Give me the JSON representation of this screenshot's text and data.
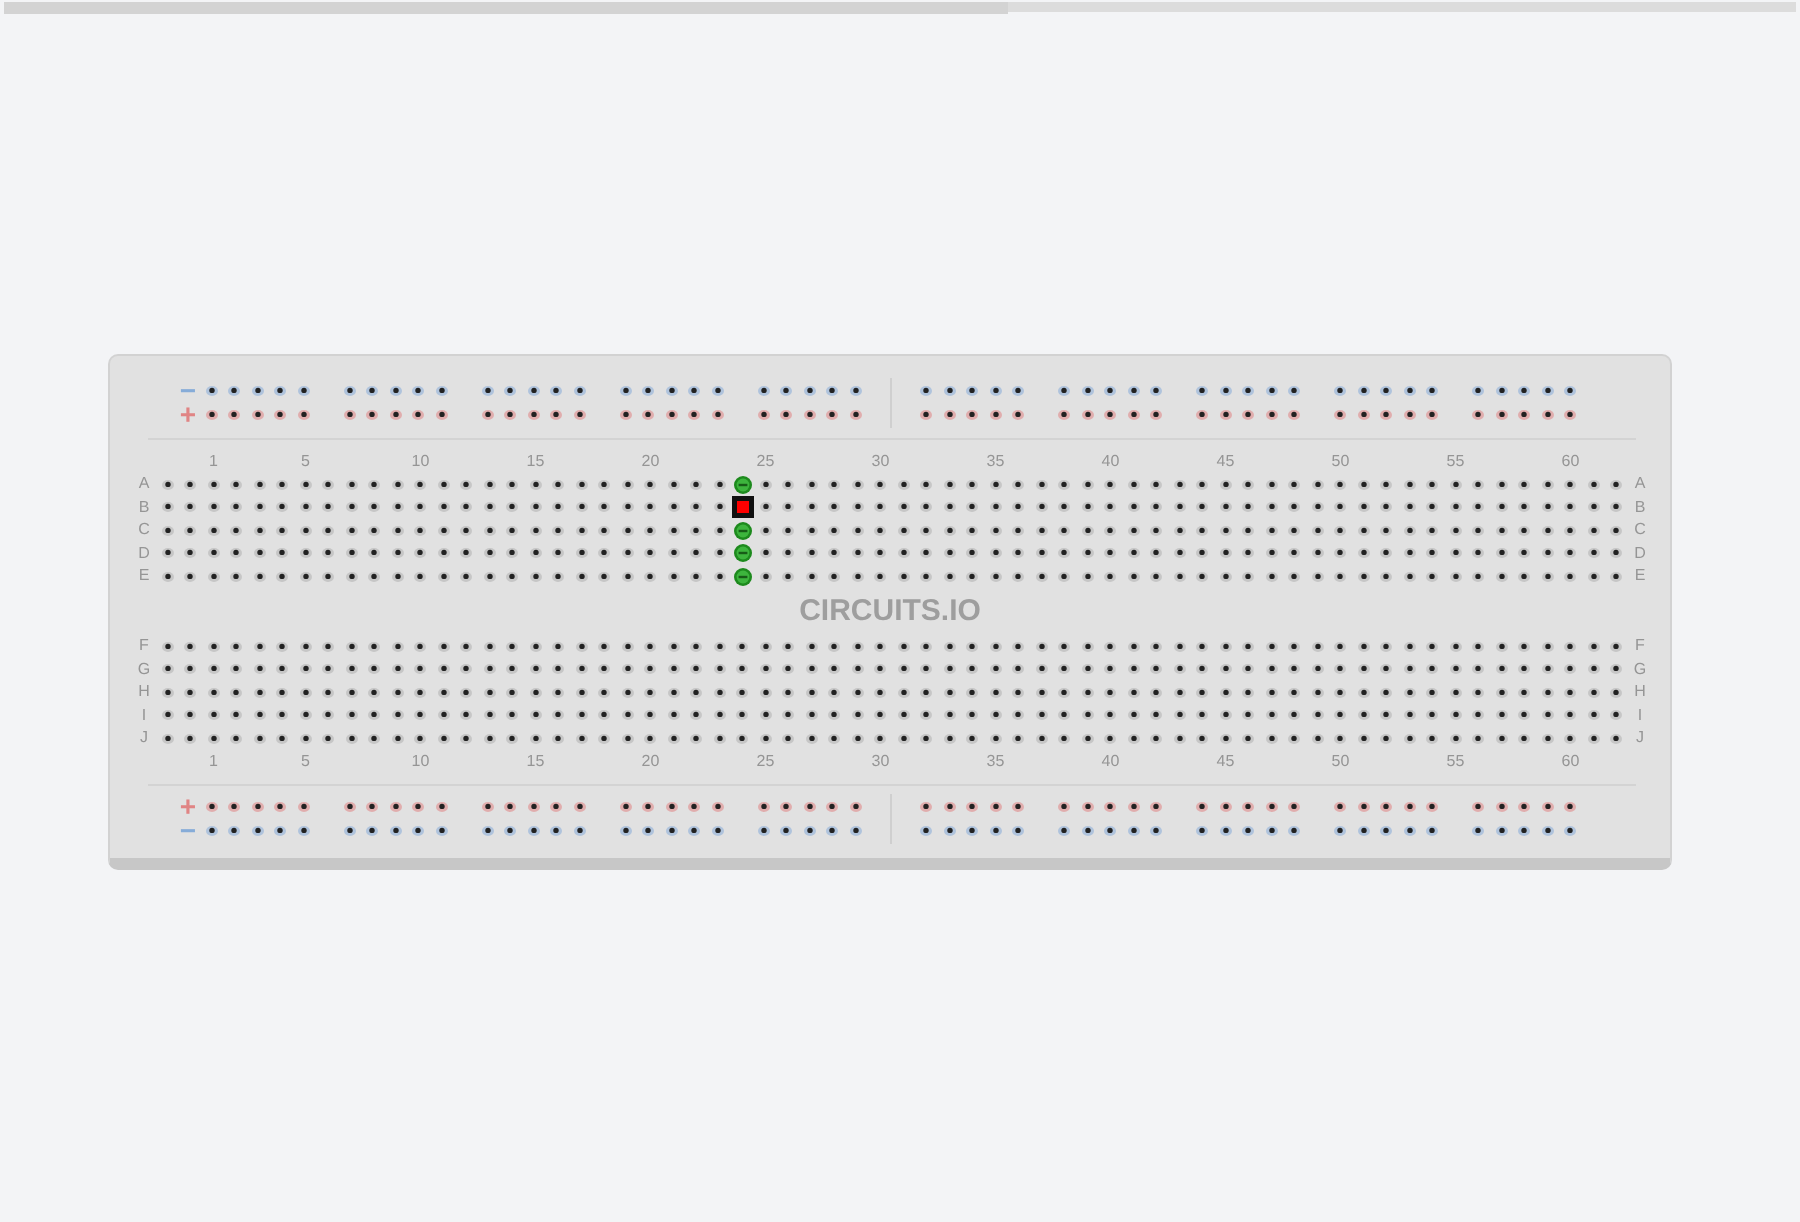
{
  "top_bar": {
    "level": 0.56
  },
  "breadboard": {
    "top_rails": [
      {
        "sign": "−",
        "color": "#86acd8"
      },
      {
        "sign": "+",
        "color": "#e08484"
      }
    ],
    "top_column_numbers": [
      "1",
      "5",
      "10",
      "15",
      "20",
      "25",
      "30",
      "35",
      "40",
      "45",
      "50",
      "55",
      "60"
    ],
    "terminal_rows_upper": [
      {
        "label": "A",
        "label_right": "A",
        "holes": [
          {
            "kind": "open"
          },
          {
            "kind": "open"
          },
          {
            "kind": "open"
          },
          {
            "kind": "open"
          },
          {
            "kind": "open"
          },
          {
            "kind": "open"
          },
          {
            "kind": "open"
          },
          {
            "kind": "open"
          },
          {
            "kind": "open"
          },
          {
            "kind": "open"
          },
          {
            "kind": "open"
          },
          {
            "kind": "open"
          },
          {
            "kind": "open"
          },
          {
            "kind": "open"
          },
          {
            "kind": "open"
          },
          {
            "kind": "open"
          },
          {
            "kind": "open"
          },
          {
            "kind": "open"
          },
          {
            "kind": "open"
          },
          {
            "kind": "open"
          },
          {
            "kind": "open"
          },
          {
            "kind": "open"
          },
          {
            "kind": "open"
          },
          {
            "kind": "open"
          },
          {
            "kind": "open"
          },
          {
            "kind": "connected"
          },
          {
            "kind": "open"
          },
          {
            "kind": "open"
          },
          {
            "kind": "open"
          },
          {
            "kind": "open"
          },
          {
            "kind": "open"
          },
          {
            "kind": "open"
          },
          {
            "kind": "open"
          },
          {
            "kind": "open"
          },
          {
            "kind": "open"
          },
          {
            "kind": "open"
          },
          {
            "kind": "open"
          },
          {
            "kind": "open"
          },
          {
            "kind": "open"
          },
          {
            "kind": "open"
          },
          {
            "kind": "open"
          },
          {
            "kind": "open"
          },
          {
            "kind": "open"
          },
          {
            "kind": "open"
          },
          {
            "kind": "open"
          },
          {
            "kind": "open"
          },
          {
            "kind": "open"
          },
          {
            "kind": "open"
          },
          {
            "kind": "open"
          },
          {
            "kind": "open"
          },
          {
            "kind": "open"
          },
          {
            "kind": "open"
          },
          {
            "kind": "open"
          },
          {
            "kind": "open"
          },
          {
            "kind": "open"
          },
          {
            "kind": "open"
          },
          {
            "kind": "open"
          },
          {
            "kind": "open"
          },
          {
            "kind": "open"
          },
          {
            "kind": "open"
          },
          {
            "kind": "open"
          },
          {
            "kind": "open"
          },
          {
            "kind": "open"
          },
          {
            "kind": "open"
          }
        ]
      },
      {
        "label": "B",
        "label_right": "B",
        "holes": [
          {
            "kind": "open"
          },
          {
            "kind": "open"
          },
          {
            "kind": "open"
          },
          {
            "kind": "open"
          },
          {
            "kind": "open"
          },
          {
            "kind": "open"
          },
          {
            "kind": "open"
          },
          {
            "kind": "open"
          },
          {
            "kind": "open"
          },
          {
            "kind": "open"
          },
          {
            "kind": "open"
          },
          {
            "kind": "open"
          },
          {
            "kind": "open"
          },
          {
            "kind": "open"
          },
          {
            "kind": "open"
          },
          {
            "kind": "open"
          },
          {
            "kind": "open"
          },
          {
            "kind": "open"
          },
          {
            "kind": "open"
          },
          {
            "kind": "open"
          },
          {
            "kind": "open"
          },
          {
            "kind": "open"
          },
          {
            "kind": "open"
          },
          {
            "kind": "open"
          },
          {
            "kind": "open"
          },
          {
            "kind": "selected"
          },
          {
            "kind": "open"
          },
          {
            "kind": "open"
          },
          {
            "kind": "open"
          },
          {
            "kind": "open"
          },
          {
            "kind": "open"
          },
          {
            "kind": "open"
          },
          {
            "kind": "open"
          },
          {
            "kind": "open"
          },
          {
            "kind": "open"
          },
          {
            "kind": "open"
          },
          {
            "kind": "open"
          },
          {
            "kind": "open"
          },
          {
            "kind": "open"
          },
          {
            "kind": "open"
          },
          {
            "kind": "open"
          },
          {
            "kind": "open"
          },
          {
            "kind": "open"
          },
          {
            "kind": "open"
          },
          {
            "kind": "open"
          },
          {
            "kind": "open"
          },
          {
            "kind": "open"
          },
          {
            "kind": "open"
          },
          {
            "kind": "open"
          },
          {
            "kind": "open"
          },
          {
            "kind": "open"
          },
          {
            "kind": "open"
          },
          {
            "kind": "open"
          },
          {
            "kind": "open"
          },
          {
            "kind": "open"
          },
          {
            "kind": "open"
          },
          {
            "kind": "open"
          },
          {
            "kind": "open"
          },
          {
            "kind": "open"
          },
          {
            "kind": "open"
          },
          {
            "kind": "open"
          },
          {
            "kind": "open"
          },
          {
            "kind": "open"
          },
          {
            "kind": "open"
          }
        ]
      },
      {
        "label": "C",
        "label_right": "C",
        "holes": [
          {
            "kind": "open"
          },
          {
            "kind": "open"
          },
          {
            "kind": "open"
          },
          {
            "kind": "open"
          },
          {
            "kind": "open"
          },
          {
            "kind": "open"
          },
          {
            "kind": "open"
          },
          {
            "kind": "open"
          },
          {
            "kind": "open"
          },
          {
            "kind": "open"
          },
          {
            "kind": "open"
          },
          {
            "kind": "open"
          },
          {
            "kind": "open"
          },
          {
            "kind": "open"
          },
          {
            "kind": "open"
          },
          {
            "kind": "open"
          },
          {
            "kind": "open"
          },
          {
            "kind": "open"
          },
          {
            "kind": "open"
          },
          {
            "kind": "open"
          },
          {
            "kind": "open"
          },
          {
            "kind": "open"
          },
          {
            "kind": "open"
          },
          {
            "kind": "open"
          },
          {
            "kind": "open"
          },
          {
            "kind": "connected"
          },
          {
            "kind": "open"
          },
          {
            "kind": "open"
          },
          {
            "kind": "open"
          },
          {
            "kind": "open"
          },
          {
            "kind": "open"
          },
          {
            "kind": "open"
          },
          {
            "kind": "open"
          },
          {
            "kind": "open"
          },
          {
            "kind": "open"
          },
          {
            "kind": "open"
          },
          {
            "kind": "open"
          },
          {
            "kind": "open"
          },
          {
            "kind": "open"
          },
          {
            "kind": "open"
          },
          {
            "kind": "open"
          },
          {
            "kind": "open"
          },
          {
            "kind": "open"
          },
          {
            "kind": "open"
          },
          {
            "kind": "open"
          },
          {
            "kind": "open"
          },
          {
            "kind": "open"
          },
          {
            "kind": "open"
          },
          {
            "kind": "open"
          },
          {
            "kind": "open"
          },
          {
            "kind": "open"
          },
          {
            "kind": "open"
          },
          {
            "kind": "open"
          },
          {
            "kind": "open"
          },
          {
            "kind": "open"
          },
          {
            "kind": "open"
          },
          {
            "kind": "open"
          },
          {
            "kind": "open"
          },
          {
            "kind": "open"
          },
          {
            "kind": "open"
          },
          {
            "kind": "open"
          },
          {
            "kind": "open"
          },
          {
            "kind": "open"
          },
          {
            "kind": "open"
          }
        ]
      },
      {
        "label": "D",
        "label_right": "D",
        "holes": [
          {
            "kind": "open"
          },
          {
            "kind": "open"
          },
          {
            "kind": "open"
          },
          {
            "kind": "open"
          },
          {
            "kind": "open"
          },
          {
            "kind": "open"
          },
          {
            "kind": "open"
          },
          {
            "kind": "open"
          },
          {
            "kind": "open"
          },
          {
            "kind": "open"
          },
          {
            "kind": "open"
          },
          {
            "kind": "open"
          },
          {
            "kind": "open"
          },
          {
            "kind": "open"
          },
          {
            "kind": "open"
          },
          {
            "kind": "open"
          },
          {
            "kind": "open"
          },
          {
            "kind": "open"
          },
          {
            "kind": "open"
          },
          {
            "kind": "open"
          },
          {
            "kind": "open"
          },
          {
            "kind": "open"
          },
          {
            "kind": "open"
          },
          {
            "kind": "open"
          },
          {
            "kind": "open"
          },
          {
            "kind": "connected"
          },
          {
            "kind": "open"
          },
          {
            "kind": "open"
          },
          {
            "kind": "open"
          },
          {
            "kind": "open"
          },
          {
            "kind": "open"
          },
          {
            "kind": "open"
          },
          {
            "kind": "open"
          },
          {
            "kind": "open"
          },
          {
            "kind": "open"
          },
          {
            "kind": "open"
          },
          {
            "kind": "open"
          },
          {
            "kind": "open"
          },
          {
            "kind": "open"
          },
          {
            "kind": "open"
          },
          {
            "kind": "open"
          },
          {
            "kind": "open"
          },
          {
            "kind": "open"
          },
          {
            "kind": "open"
          },
          {
            "kind": "open"
          },
          {
            "kind": "open"
          },
          {
            "kind": "open"
          },
          {
            "kind": "open"
          },
          {
            "kind": "open"
          },
          {
            "kind": "open"
          },
          {
            "kind": "open"
          },
          {
            "kind": "open"
          },
          {
            "kind": "open"
          },
          {
            "kind": "open"
          },
          {
            "kind": "open"
          },
          {
            "kind": "open"
          },
          {
            "kind": "open"
          },
          {
            "kind": "open"
          },
          {
            "kind": "open"
          },
          {
            "kind": "open"
          },
          {
            "kind": "open"
          },
          {
            "kind": "open"
          },
          {
            "kind": "open"
          },
          {
            "kind": "open"
          }
        ]
      },
      {
        "label": "E",
        "label_right": "E",
        "holes": [
          {
            "kind": "open"
          },
          {
            "kind": "open"
          },
          {
            "kind": "open"
          },
          {
            "kind": "open"
          },
          {
            "kind": "open"
          },
          {
            "kind": "open"
          },
          {
            "kind": "open"
          },
          {
            "kind": "open"
          },
          {
            "kind": "open"
          },
          {
            "kind": "open"
          },
          {
            "kind": "open"
          },
          {
            "kind": "open"
          },
          {
            "kind": "open"
          },
          {
            "kind": "open"
          },
          {
            "kind": "open"
          },
          {
            "kind": "open"
          },
          {
            "kind": "open"
          },
          {
            "kind": "open"
          },
          {
            "kind": "open"
          },
          {
            "kind": "open"
          },
          {
            "kind": "open"
          },
          {
            "kind": "open"
          },
          {
            "kind": "open"
          },
          {
            "kind": "open"
          },
          {
            "kind": "open"
          },
          {
            "kind": "connected"
          },
          {
            "kind": "open"
          },
          {
            "kind": "open"
          },
          {
            "kind": "open"
          },
          {
            "kind": "open"
          },
          {
            "kind": "open"
          },
          {
            "kind": "open"
          },
          {
            "kind": "open"
          },
          {
            "kind": "open"
          },
          {
            "kind": "open"
          },
          {
            "kind": "open"
          },
          {
            "kind": "open"
          },
          {
            "kind": "open"
          },
          {
            "kind": "open"
          },
          {
            "kind": "open"
          },
          {
            "kind": "open"
          },
          {
            "kind": "open"
          },
          {
            "kind": "open"
          },
          {
            "kind": "open"
          },
          {
            "kind": "open"
          },
          {
            "kind": "open"
          },
          {
            "kind": "open"
          },
          {
            "kind": "open"
          },
          {
            "kind": "open"
          },
          {
            "kind": "open"
          },
          {
            "kind": "open"
          },
          {
            "kind": "open"
          },
          {
            "kind": "open"
          },
          {
            "kind": "open"
          },
          {
            "kind": "open"
          },
          {
            "kind": "open"
          },
          {
            "kind": "open"
          },
          {
            "kind": "open"
          },
          {
            "kind": "open"
          },
          {
            "kind": "open"
          },
          {
            "kind": "open"
          },
          {
            "kind": "open"
          },
          {
            "kind": "open"
          },
          {
            "kind": "open"
          }
        ]
      }
    ],
    "logo": "CIRCUITS.IO",
    "terminal_rows_lower": [
      {
        "label": "F",
        "label_right": "F"
      },
      {
        "label": "G",
        "label_right": "G"
      },
      {
        "label": "H",
        "label_right": "H"
      },
      {
        "label": "I",
        "label_right": "I"
      },
      {
        "label": "J",
        "label_right": "J"
      }
    ],
    "bottom_column_numbers": [
      "1",
      "5",
      "10",
      "15",
      "20",
      "25",
      "30",
      "35",
      "40",
      "45",
      "50",
      "55",
      "60"
    ],
    "bottom_rails": [
      {
        "sign": "+",
        "color": "#e08484"
      },
      {
        "sign": "−",
        "color": "#86acd8"
      }
    ]
  }
}
